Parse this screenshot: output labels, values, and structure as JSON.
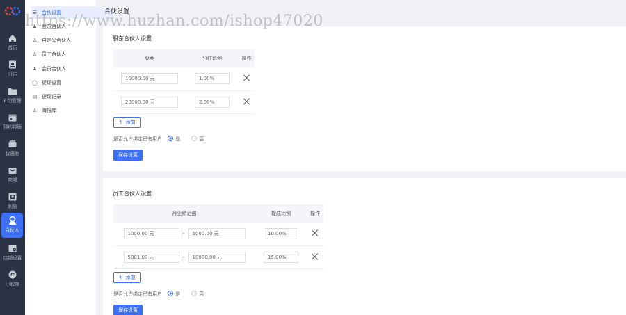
{
  "rail": {
    "items": [
      {
        "label": "首页",
        "icon": "home-icon"
      },
      {
        "label": "分员",
        "icon": "member-icon"
      },
      {
        "label": "F.动管理",
        "icon": "folder-icon"
      },
      {
        "label": "预约排版",
        "icon": "calendar-icon"
      },
      {
        "label": "优惠券",
        "icon": "coupon-icon"
      },
      {
        "label": "商城",
        "icon": "mall-icon"
      },
      {
        "label": "利盈",
        "icon": "chart-icon"
      },
      {
        "label": "合伙人",
        "icon": "partner-icon"
      },
      {
        "label": "店铺设置",
        "icon": "store-settings-icon"
      },
      {
        "label": "小程序",
        "icon": "miniapp-icon"
      }
    ]
  },
  "submenu": {
    "items": [
      {
        "label": "合伙设置",
        "icon": "settings-list-icon"
      },
      {
        "label": "股东合伙人",
        "icon": "shareholder-icon"
      },
      {
        "label": "自定义合伙人",
        "icon": "custom-partner-icon"
      },
      {
        "label": "员工合伙人",
        "icon": "staff-icon"
      },
      {
        "label": "会员合伙人",
        "icon": "vip-icon"
      },
      {
        "label": "提现设置",
        "icon": "withdraw-icon"
      },
      {
        "label": "提现记录",
        "icon": "record-icon"
      },
      {
        "label": "海报库",
        "icon": "poster-icon"
      }
    ]
  },
  "page_title": "合伙设置",
  "watermark": "https://www.huzhan.com/ishop47020",
  "shareholder": {
    "title": "股东合伙人设置",
    "headers": [
      "股金",
      "分红比例",
      "操作"
    ],
    "rows": [
      {
        "amount": "10000.00 元",
        "ratio": "1.00%"
      },
      {
        "amount": "20000.00 元",
        "ratio": "2.00%"
      }
    ],
    "add_label": "添加",
    "bind_question": "是否允许绑定已有用户",
    "yes": "是",
    "no": "否",
    "save_label": "保存设置"
  },
  "staff": {
    "title": "员工合伙人设置",
    "headers": [
      "月业绩范围",
      "提成比例",
      "操作"
    ],
    "rows": [
      {
        "from": "1000.00 元",
        "to": "5000.00 元",
        "ratio": "10.00%"
      },
      {
        "from": "5001.00 元",
        "to": "10000.00 元",
        "ratio": "15.00%"
      }
    ],
    "separator": "-",
    "add_label": "添加",
    "bind_question": "是否允许绑定已有用户",
    "yes": "是",
    "no": "否",
    "save_label": "保存设置"
  },
  "colors": {
    "accent": "#3c6ef6",
    "rail": "#2b3244"
  }
}
